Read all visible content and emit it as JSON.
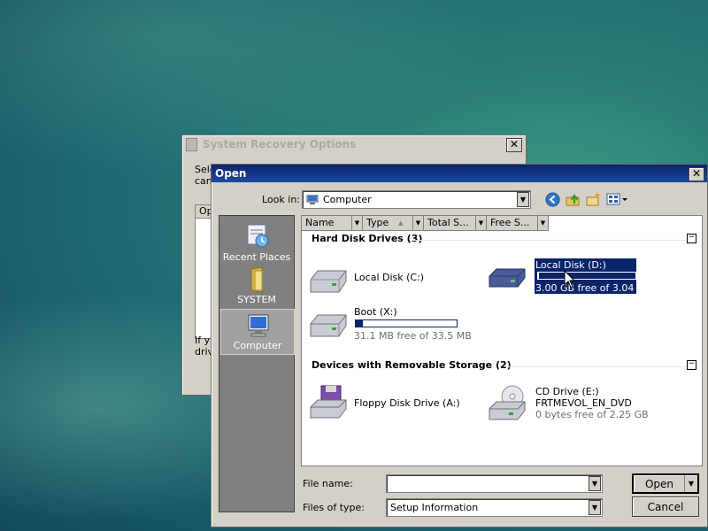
{
  "recovery": {
    "title": "System Recovery Options",
    "text_top_1": "Sele",
    "text_top_2": "can",
    "list_hdr": "Op",
    "text_bottom_1": "If y",
    "text_bottom_2": "driv"
  },
  "open": {
    "title": "Open",
    "look_in_label": "Look in:",
    "look_in_value": "Computer",
    "columns": [
      "Name",
      "Type",
      "Total S...",
      "Free S..."
    ],
    "places": [
      {
        "label": "Recent Places",
        "icon": "recent-places-icon"
      },
      {
        "label": "SYSTEM",
        "icon": "folder-icon"
      },
      {
        "label": "Computer",
        "icon": "computer-icon"
      }
    ],
    "groups": {
      "hdd": "Hard Disk Drives (3)",
      "removable": "Devices with Removable Storage (2)"
    },
    "drives": {
      "c": {
        "label": "Local Disk (C:)"
      },
      "d": {
        "label": "Local Disk (D:)",
        "free": "3.00 GB free of 3.04 GB",
        "used_fraction": 0.013
      },
      "x": {
        "label": "Boot (X:)",
        "free": "31.1 MB free of 33.5 MB",
        "used_fraction": 0.072
      },
      "a": {
        "label": "Floppy Disk Drive (A:)"
      },
      "e": {
        "label": "CD Drive (E:)",
        "label2": "FRTMEVOL_EN_DVD",
        "free": "0 bytes free of 2.25 GB"
      }
    },
    "file_name_label": "File name:",
    "file_name_value": "",
    "file_type_label": "Files of type:",
    "file_type_value": "Setup Information",
    "open_button": "Open",
    "cancel_button": "Cancel",
    "close_glyph": "✕",
    "collapse_glyph": "−"
  }
}
